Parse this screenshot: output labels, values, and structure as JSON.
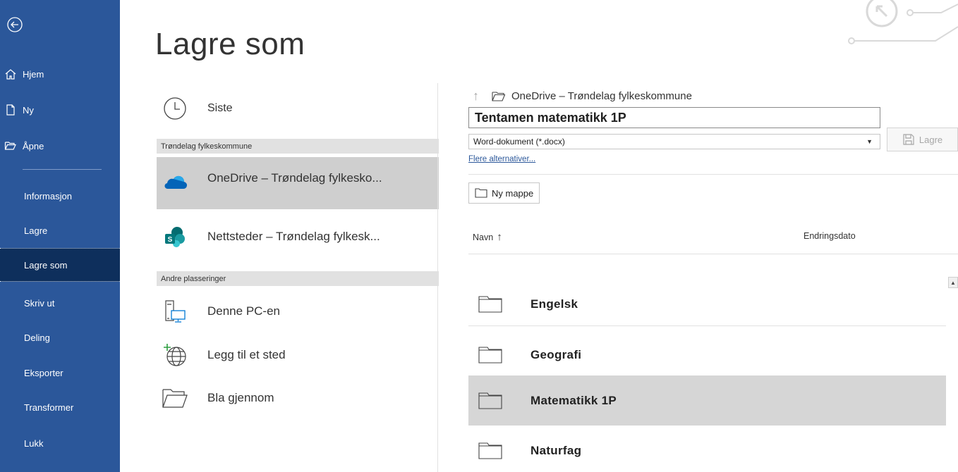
{
  "nav": {
    "top_items": [
      {
        "label": "Hjem",
        "icon": "home-icon"
      },
      {
        "label": "Ny",
        "icon": "new-document-icon"
      },
      {
        "label": "Åpne",
        "icon": "open-folder-icon"
      }
    ],
    "items": [
      {
        "label": "Informasjon"
      },
      {
        "label": "Lagre"
      },
      {
        "label": "Lagre som"
      },
      {
        "label": "Skriv ut"
      },
      {
        "label": "Deling"
      },
      {
        "label": "Eksporter"
      },
      {
        "label": "Transformer"
      },
      {
        "label": "Lukk"
      }
    ],
    "active_item": "Lagre som"
  },
  "page": {
    "title": "Lagre som"
  },
  "locations": {
    "recent_label": "Siste",
    "org_header": "Trøndelag fylkeskommune",
    "onedrive_label": "OneDrive – Trøndelag fylkesko...",
    "sites_label": "Nettsteder – Trøndelag fylkesk...",
    "other_header": "Andre plasseringer",
    "this_pc_label": "Denne PC-en",
    "add_place_label": "Legg til et sted",
    "browse_label": "Bla gjennom"
  },
  "save_pane": {
    "breadcrumb": "OneDrive – Trøndelag fylkeskommune",
    "filename_value": "Tentamen matematikk 1P",
    "filetype_value": "Word-dokument (*.docx)",
    "save_label": "Lagre",
    "more_options": "Flere alternativer...",
    "new_folder_label": "Ny mappe",
    "col_name": "Navn",
    "col_date": "Endringsdato",
    "folders": [
      {
        "name": "Engelsk",
        "selected": false
      },
      {
        "name": "Geografi",
        "selected": false
      },
      {
        "name": "Matematikk 1P",
        "selected": true
      },
      {
        "name": "Naturfag",
        "selected": false
      }
    ]
  },
  "colors": {
    "nav_bg": "#2b579a",
    "nav_active": "#0e2f5c",
    "onedrive_blue": "#0364b8",
    "sharepoint_teal": "#038387",
    "link_blue": "#2b579a"
  }
}
